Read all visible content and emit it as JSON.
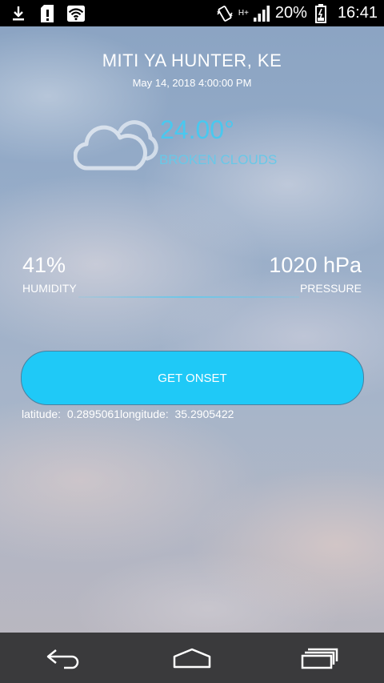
{
  "status_bar": {
    "icons": [
      "download-icon",
      "sd-card-alert-icon",
      "wifi-icon",
      "vibrate-icon",
      "signal-icon",
      "battery-icon"
    ],
    "network": "H+",
    "battery": "20%",
    "time": "16:41"
  },
  "weather": {
    "location": "MITI YA HUNTER, KE",
    "datetime": "May 14, 2018 4:00:00 PM",
    "icon": "cloud-icon",
    "temperature": "24.00°",
    "condition": "BROKEN CLOUDS"
  },
  "stats": {
    "humidity_value": "41%",
    "humidity_label": "HUMIDITY",
    "pressure_value": "1020 hPa",
    "pressure_label": "PRESSURE"
  },
  "action": {
    "button_label": "GET ONSET",
    "coordinates": "latitude:  0.2895061longitude:  35.2905422"
  },
  "colors": {
    "accent": "#1fc9f7",
    "temperature": "#49c8ef"
  },
  "nav": {
    "items": [
      "back-icon",
      "home-icon",
      "recents-icon"
    ]
  }
}
